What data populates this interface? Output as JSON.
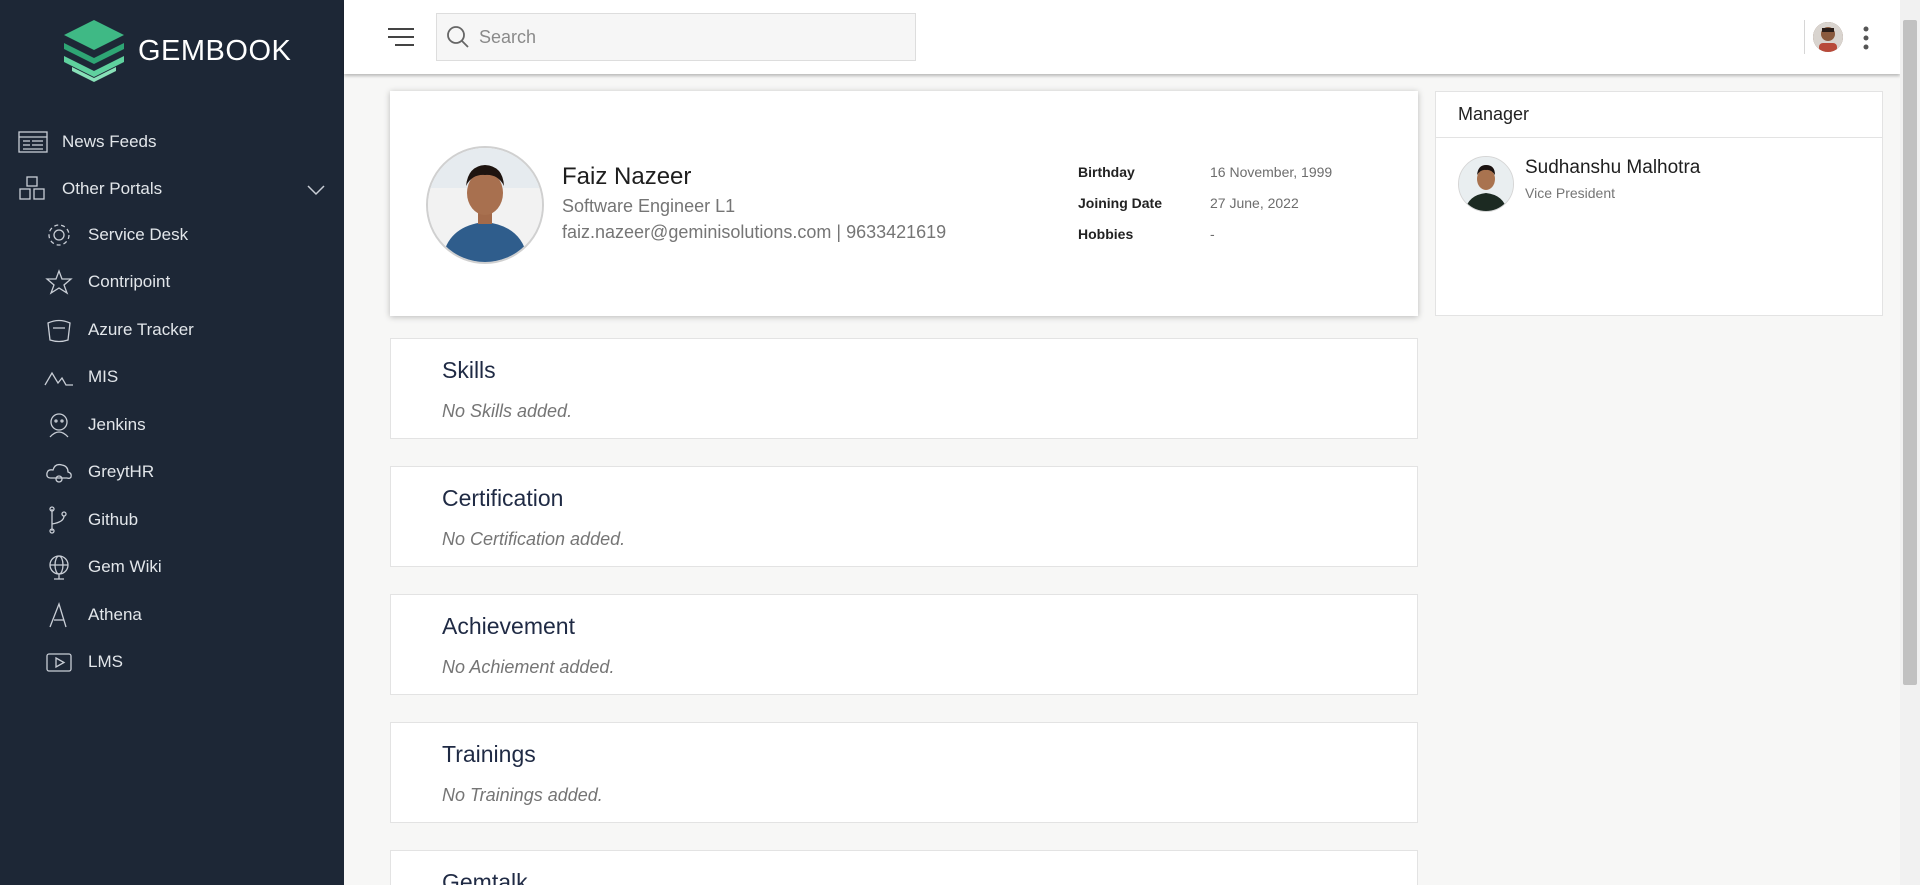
{
  "brand": {
    "name": "GEMBOOK"
  },
  "sidebar": {
    "items": [
      {
        "label": "News Feeds",
        "icon": "news-feed-icon"
      },
      {
        "label": "Other Portals",
        "icon": "portals-icon"
      },
      {
        "label": "Service Desk",
        "icon": "gear-icon"
      },
      {
        "label": "Contripoint",
        "icon": "star-icon"
      },
      {
        "label": "Azure Tracker",
        "icon": "tracker-icon"
      },
      {
        "label": "MIS",
        "icon": "chart-line-icon"
      },
      {
        "label": "Jenkins",
        "icon": "jenkins-icon"
      },
      {
        "label": "GreytHR",
        "icon": "cloud-icon"
      },
      {
        "label": "Github",
        "icon": "git-branch-icon"
      },
      {
        "label": "Gem Wiki",
        "icon": "globe-icon"
      },
      {
        "label": "Athena",
        "icon": "athena-icon"
      },
      {
        "label": "LMS",
        "icon": "video-icon"
      }
    ]
  },
  "topbar": {
    "search_placeholder": "Search"
  },
  "profile": {
    "name": "Faiz Nazeer",
    "role": "Software Engineer L1",
    "contact": "faiz.nazeer@geminisolutions.com | 9633421619",
    "details": [
      {
        "label": "Birthday",
        "value": "16 November, 1999"
      },
      {
        "label": "Joining Date",
        "value": "27 June, 2022"
      },
      {
        "label": "Hobbies",
        "value": "-"
      }
    ]
  },
  "manager": {
    "title": "Manager",
    "name": "Sudhanshu Malhotra",
    "role": "Vice President"
  },
  "sections": [
    {
      "title": "Skills",
      "empty_text": "No Skills added."
    },
    {
      "title": "Certification",
      "empty_text": "No Certification added."
    },
    {
      "title": "Achievement",
      "empty_text": "No Achiement added."
    },
    {
      "title": "Trainings",
      "empty_text": "No Trainings added."
    },
    {
      "title": "Gemtalk",
      "empty_text": ""
    }
  ],
  "colors": {
    "sidebar_bg": "#1d2736",
    "logo_green": "#3dbb83",
    "heading": "#1f2a44"
  }
}
